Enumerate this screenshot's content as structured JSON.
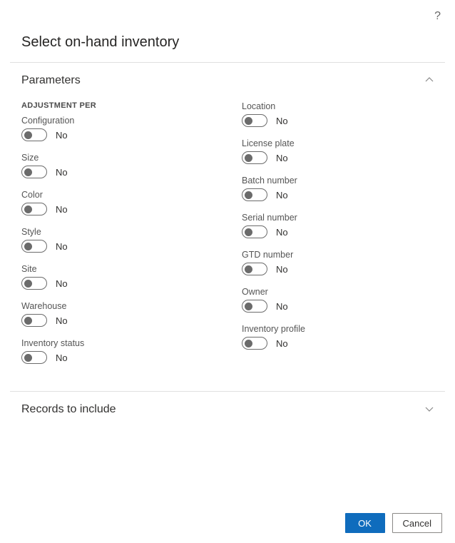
{
  "help_tooltip": "?",
  "dialog": {
    "title": "Select on-hand inventory"
  },
  "sections": {
    "parameters": {
      "title": "Parameters",
      "expanded": true
    },
    "records": {
      "title": "Records to include",
      "expanded": false
    }
  },
  "adjustment_per": {
    "header": "ADJUSTMENT PER",
    "off_label": "No",
    "left": [
      {
        "key": "configuration",
        "label": "Configuration"
      },
      {
        "key": "size",
        "label": "Size"
      },
      {
        "key": "color",
        "label": "Color"
      },
      {
        "key": "style",
        "label": "Style"
      },
      {
        "key": "site",
        "label": "Site"
      },
      {
        "key": "warehouse",
        "label": "Warehouse"
      },
      {
        "key": "inventory_status",
        "label": "Inventory status"
      }
    ],
    "right": [
      {
        "key": "location",
        "label": "Location"
      },
      {
        "key": "license_plate",
        "label": "License plate"
      },
      {
        "key": "batch_number",
        "label": "Batch number"
      },
      {
        "key": "serial_number",
        "label": "Serial number"
      },
      {
        "key": "gtd_number",
        "label": "GTD number"
      },
      {
        "key": "owner",
        "label": "Owner"
      },
      {
        "key": "inventory_profile",
        "label": "Inventory profile"
      }
    ]
  },
  "buttons": {
    "ok": "OK",
    "cancel": "Cancel"
  }
}
